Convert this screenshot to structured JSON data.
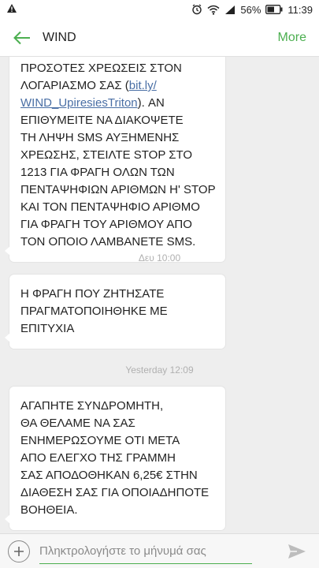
{
  "status_bar": {
    "warning_icon": "warning-icon",
    "battery_percent": "56%",
    "time": "11:39"
  },
  "header": {
    "title": "WIND",
    "more_label": "More"
  },
  "messages": [
    {
      "lines": [
        "ΠΡΟΣΟΤΕΣ ΧΡΕΩΣΕΙΣ ΣΤΟΝ",
        "ΛΟΓΑΡΙΑΣΜΟ ΣΑΣ (",
        "bit.ly/",
        "WIND_UpiresiesTriton",
        "). ΑΝ",
        "ΕΠΙΘΥΜΕΙΤΕ ΝΑ ΔΙΑΚΟΨΕΤΕ",
        "ΤΗ ΛΗΨΗ SMS ΑΥΞΗΜΕΝΗΣ",
        "ΧΡΕΩΣΗΣ, ΣΤΕΙΛΤΕ STOP ΣΤΟ",
        "1213 ΓΙΑ ΦΡΑΓΗ ΟΛΩΝ ΤΩΝ",
        "ΠΕΝΤΑΨΗΦΙΩΝ ΑΡΙΘΜΩΝ Η' STOP",
        "ΚΑΙ ΤΟΝ ΠΕΝΤΑΨΗΦΙΟ ΑΡΙΘΜΟ",
        "ΓΙΑ ΦΡΑΓΗ ΤΟΥ ΑΡΙΘΜΟΥ ΑΠΟ",
        "ΤΟΝ ΟΠΟΙΟ ΛΑΜΒΑΝΕΤΕ SMS."
      ]
    },
    {
      "timestamp": "Δευ 10:00",
      "lines": [
        "Η ΦΡΑΓΗ ΠΟΥ ΖΗΤΗΣΑΤΕ",
        "ΠΡΑΓΜΑΤΟΠΟΙΗΘΗΚΕ ΜΕ",
        "ΕΠΙΤΥΧΙΑ"
      ]
    },
    {
      "timestamp": "Yesterday 12:09",
      "lines": [
        "ΑΓΑΠΗΤΕ ΣΥΝΔΡΟΜΗΤΗ,",
        "ΘΑ ΘΕΛΑΜΕ ΝΑ ΣΑΣ",
        "ΕΝΗΜΕΡΩΣΟΥΜΕ ΟΤΙ ΜΕΤΑ",
        "ΑΠΟ ΕΛΕΓΧΟ ΤΗΣ ΓΡΑΜΜΗ",
        "ΣΑΣ ΑΠΟΔΟΘΗΚΑΝ 6,25€ ΣΤΗΝ",
        "ΔΙΑΘΕΣΗ ΣΑΣ ΓΙΑ ΟΠΟΙΑΔΗΠΟΤΕ",
        "ΒΟΗΘΕΙΑ."
      ]
    }
  ],
  "composer": {
    "placeholder": "Πληκτρολογήστε το μήνυμά σας",
    "value": ""
  },
  "colors": {
    "accent": "#4caf50",
    "link": "#4a6fa5",
    "background": "#eeeeee"
  }
}
